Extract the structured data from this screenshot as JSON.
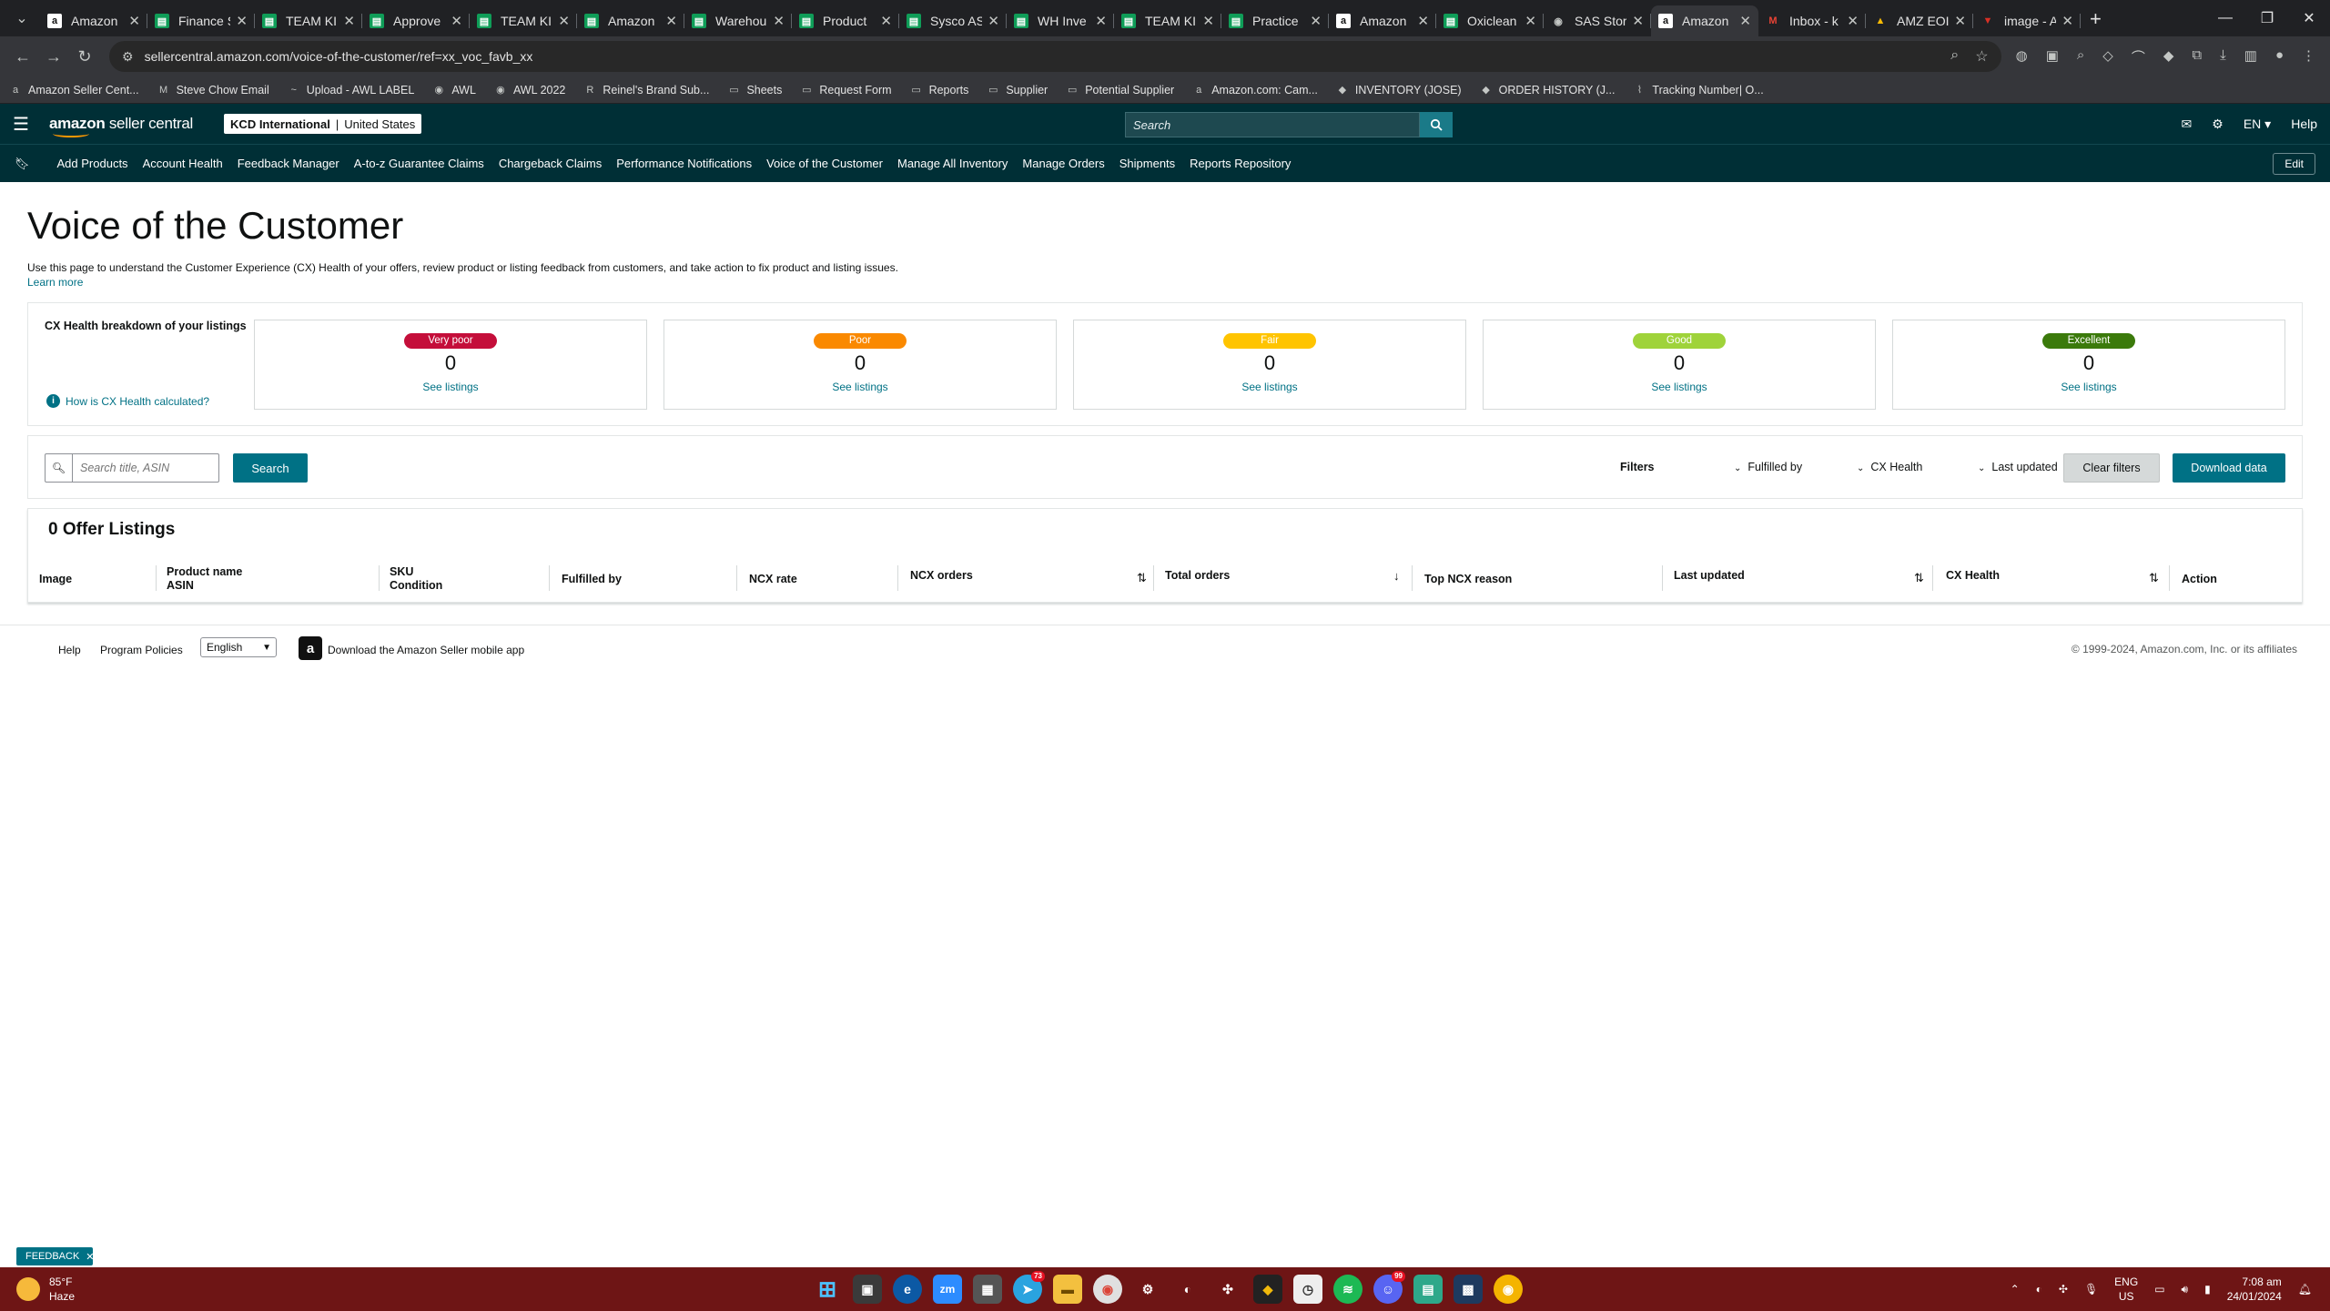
{
  "browser": {
    "tabs": [
      {
        "title": "Amazon",
        "icon": "amazon",
        "color": "#ffffff"
      },
      {
        "title": "Finance S",
        "icon": "sheets",
        "color": "#0f9d58"
      },
      {
        "title": "TEAM KIM",
        "icon": "sheets",
        "color": "#0f9d58"
      },
      {
        "title": "Approve",
        "icon": "sheets",
        "color": "#0f9d58"
      },
      {
        "title": "TEAM KIM",
        "icon": "sheets",
        "color": "#0f9d58"
      },
      {
        "title": "Amazon",
        "icon": "sheets",
        "color": "#0f9d58"
      },
      {
        "title": "Warehou",
        "icon": "sheets",
        "color": "#0f9d58"
      },
      {
        "title": "Product",
        "icon": "sheets",
        "color": "#0f9d58"
      },
      {
        "title": "Sysco AS",
        "icon": "sheets",
        "color": "#0f9d58"
      },
      {
        "title": "WH Inve",
        "icon": "sheets",
        "color": "#0f9d58"
      },
      {
        "title": "TEAM KIM",
        "icon": "sheets",
        "color": "#0f9d58"
      },
      {
        "title": "Practice",
        "icon": "sheets",
        "color": "#0f9d58"
      },
      {
        "title": "Amazon",
        "icon": "amazon",
        "color": "#ffffff"
      },
      {
        "title": "Oxiclean",
        "icon": "sheets",
        "color": "#0f9d58"
      },
      {
        "title": "SAS Store",
        "icon": "globe",
        "color": "#c4c7c5"
      },
      {
        "title": "Amazon",
        "icon": "amazon",
        "color": "#ffffff",
        "active": true
      },
      {
        "title": "Inbox - k",
        "icon": "gmail",
        "color": "#ea4335"
      },
      {
        "title": "AMZ EOI",
        "icon": "drive",
        "color": "#fbbc04"
      },
      {
        "title": "image - A",
        "icon": "red",
        "color": "#d93025"
      }
    ],
    "url": "sellercentral.amazon.com/voice-of-the-customer/ref=xx_voc_favb_xx",
    "bookmarks": [
      {
        "label": "Amazon Seller Cent...",
        "icon": "a"
      },
      {
        "label": "Steve Chow Email",
        "icon": "M"
      },
      {
        "label": "Upload - AWL LABEL",
        "icon": "~"
      },
      {
        "label": "AWL",
        "icon": "◉"
      },
      {
        "label": "AWL 2022",
        "icon": "◉"
      },
      {
        "label": "Reinel's Brand Sub...",
        "icon": "R"
      },
      {
        "label": "Sheets",
        "icon": "▭"
      },
      {
        "label": "Request Form",
        "icon": "▭"
      },
      {
        "label": "Reports",
        "icon": "▭"
      },
      {
        "label": "Supplier",
        "icon": "▭"
      },
      {
        "label": "Potential Supplier",
        "icon": "▭"
      },
      {
        "label": "Amazon.com: Cam...",
        "icon": "a"
      },
      {
        "label": "INVENTORY (JOSE)",
        "icon": "◆"
      },
      {
        "label": "ORDER HISTORY (J...",
        "icon": "◆"
      },
      {
        "label": "Tracking Number| O...",
        "icon": "⌇"
      }
    ]
  },
  "header": {
    "logo_main": "amazon",
    "logo_sub": " seller central",
    "account_name": "KCD International",
    "account_sep": "|",
    "account_region": "United States",
    "search_placeholder": "Search",
    "lang": "EN",
    "help": "Help"
  },
  "nav": {
    "items": [
      "Add Products",
      "Account Health",
      "Feedback Manager",
      "A-to-z Guarantee Claims",
      "Chargeback Claims",
      "Performance Notifications",
      "Voice of the Customer",
      "Manage All Inventory",
      "Manage Orders",
      "Shipments",
      "Reports Repository"
    ],
    "edit": "Edit"
  },
  "page": {
    "title": "Voice of the Customer",
    "intro": "Use this page to understand the Customer Experience (CX) Health of your offers, review product or listing feedback from customers, and take action to fix product and listing issues.",
    "learn_more": "Learn more"
  },
  "cx": {
    "title": "CX Health breakdown of your listings",
    "how": "How is CX Health calculated?",
    "cards": [
      {
        "label": "Very poor",
        "count": "0",
        "link": "See listings",
        "color": "#c40e3a",
        "text_color": "#ffffff"
      },
      {
        "label": "Poor",
        "count": "0",
        "link": "See listings",
        "color": "#fa8900",
        "text_color": "#ffffff"
      },
      {
        "label": "Fair",
        "count": "0",
        "link": "See listings",
        "color": "#ffc400",
        "text_color": "#ffffff"
      },
      {
        "label": "Good",
        "count": "0",
        "link": "See listings",
        "color": "#9fd33a",
        "text_color": "#ffffff"
      },
      {
        "label": "Excellent",
        "count": "0",
        "link": "See listings",
        "color": "#3b7a0b",
        "text_color": "#ffffff"
      }
    ]
  },
  "filters": {
    "search_placeholder": "Search title, ASIN",
    "search_button": "Search",
    "filters_label": "Filters",
    "fulfilled_by": "Fulfilled by",
    "cx_health": "CX Health",
    "last_updated": "Last updated",
    "clear": "Clear filters",
    "download": "Download data"
  },
  "listings": {
    "title": "0 Offer Listings",
    "columns": [
      "Image",
      "Product name",
      "ASIN",
      "SKU",
      "Condition",
      "Fulfilled by",
      "NCX rate",
      "NCX orders",
      "Total orders",
      "Top NCX reason",
      "Last updated",
      "CX Health",
      "Action"
    ]
  },
  "footer": {
    "help": "Help",
    "policies": "Program Policies",
    "language": "English",
    "app": "Download the Amazon Seller mobile app",
    "copyright": "© 1999-2024, Amazon.com, Inc. or its affiliates"
  },
  "feedback": "FEEDBACK",
  "taskbar": {
    "temp": "85°F",
    "weather": "Haze",
    "lang1": "ENG",
    "lang2": "US",
    "time": "7:08 am",
    "date": "24/01/2024",
    "telegram_badge": "73",
    "discord_badge": "99"
  }
}
